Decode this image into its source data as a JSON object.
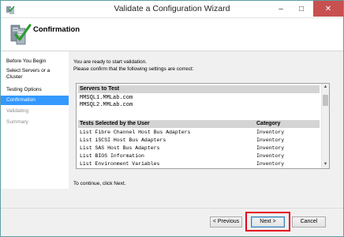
{
  "window": {
    "title": "Validate a Configuration Wizard"
  },
  "header": {
    "title": "Confirmation"
  },
  "nav": {
    "items": [
      {
        "label": "Before You Begin"
      },
      {
        "label": "Select Servers or a Cluster"
      },
      {
        "label": "Testing Options"
      },
      {
        "label": "Confirmation"
      },
      {
        "label": "Validating"
      },
      {
        "label": "Summary"
      }
    ]
  },
  "main": {
    "intro_line1": "You are ready to start validation.",
    "intro_line2": "Please confirm that the following settings are correct:",
    "servers_header": "Servers to Test",
    "servers": [
      "MMSQL1.MMLab.com",
      "MMSQL2.MMLab.com"
    ],
    "tests_header": "Tests Selected by the User",
    "category_header": "Category",
    "tests": [
      {
        "name": "List Fibre Channel Host Bus Adapters",
        "category": "Inventory"
      },
      {
        "name": "List iSCSI Host Bus Adapters",
        "category": "Inventory"
      },
      {
        "name": "List SAS Host Bus Adapters",
        "category": "Inventory"
      },
      {
        "name": "List BIOS Information",
        "category": "Inventory"
      },
      {
        "name": "List Environment Variables",
        "category": "Inventory"
      }
    ],
    "continue_text": "To continue, click Next."
  },
  "buttons": {
    "previous": "< Previous",
    "next": "Next >",
    "cancel": "Cancel"
  },
  "colors": {
    "highlight": "#e8001a",
    "selection": "#3399ff",
    "close_button": "#c75050"
  }
}
